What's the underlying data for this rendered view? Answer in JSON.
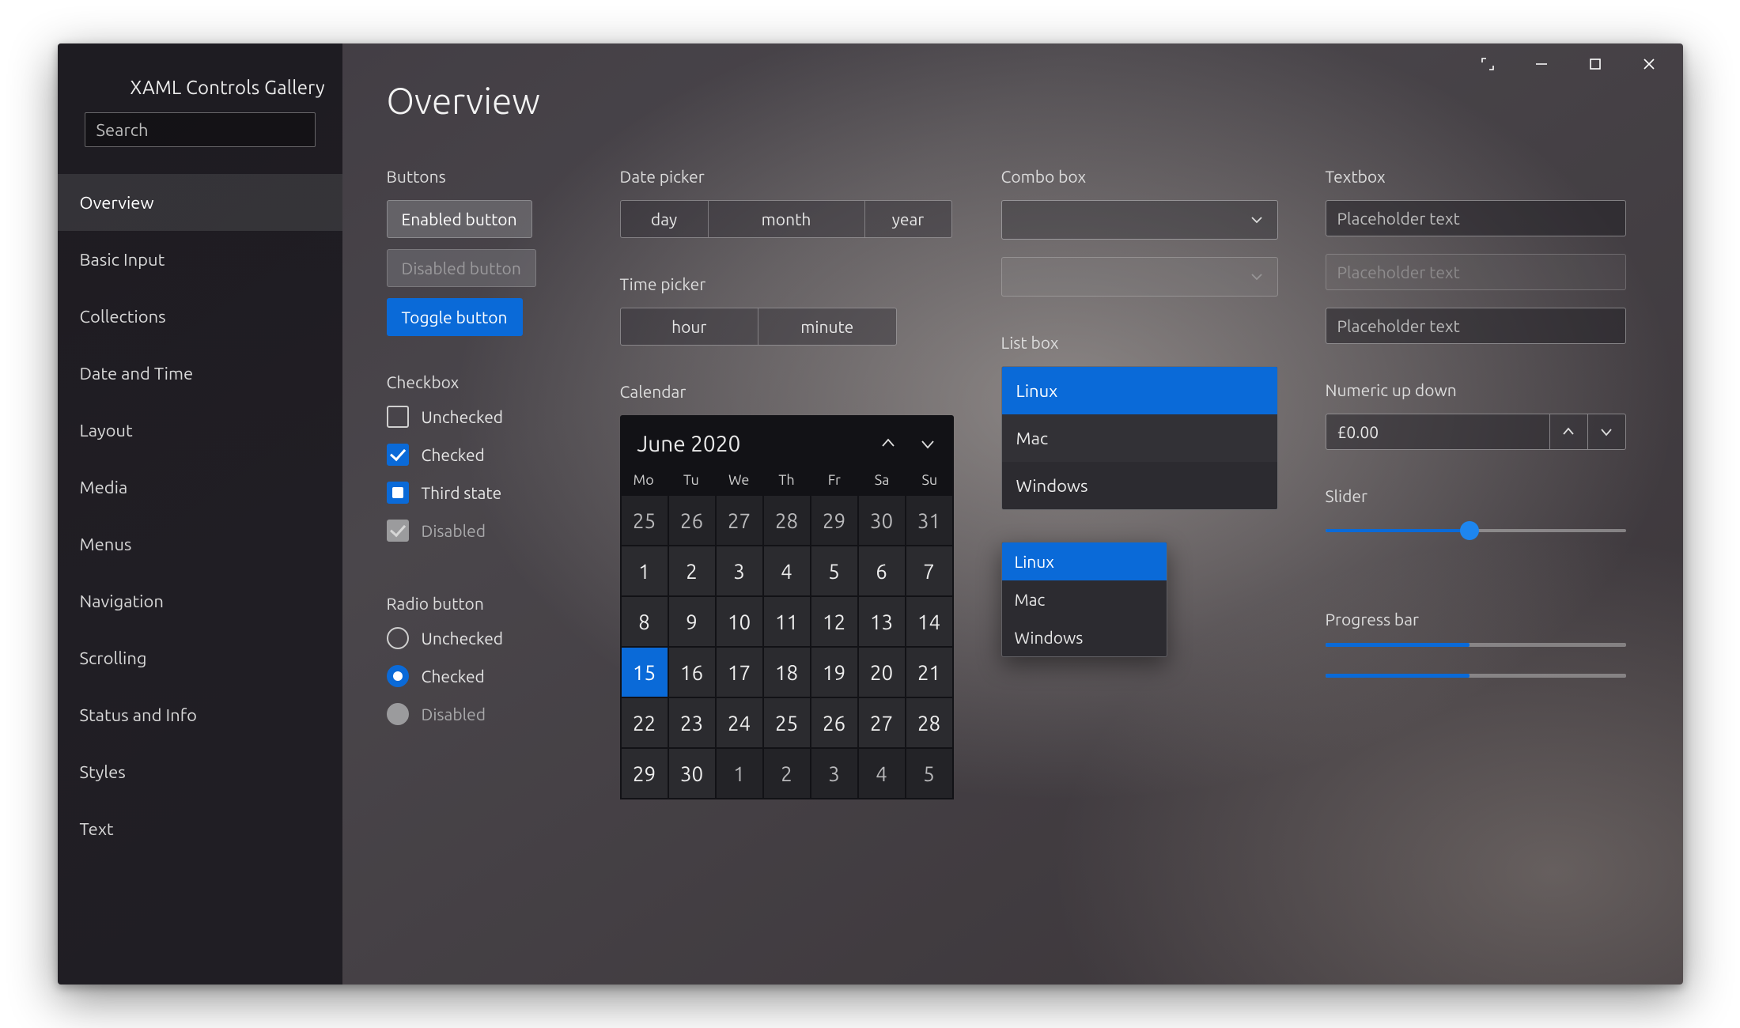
{
  "app_title": "XAML Controls Gallery",
  "search_placeholder": "Search",
  "nav": [
    "Overview",
    "Basic Input",
    "Collections",
    "Date and Time",
    "Layout",
    "Media",
    "Menus",
    "Navigation",
    "Scrolling",
    "Status and Info",
    "Styles",
    "Text"
  ],
  "nav_selected": 0,
  "page_title": "Overview",
  "sections": {
    "buttons": "Buttons",
    "checkbox": "Checkbox",
    "radio": "Radio button",
    "datepicker": "Date picker",
    "timepicker": "Time picker",
    "calendar": "Calendar",
    "combobox": "Combo box",
    "listbox": "List box",
    "textbox": "Textbox",
    "numeric": "Numeric up down",
    "slider": "Slider",
    "progress": "Progress bar"
  },
  "buttons": {
    "enabled": "Enabled button",
    "disabled": "Disabled button",
    "toggle": "Toggle button"
  },
  "checkboxes": {
    "unchecked": "Unchecked",
    "checked": "Checked",
    "third": "Third state",
    "disabled": "Disabled"
  },
  "radios": {
    "unchecked": "Unchecked",
    "checked": "Checked",
    "disabled": "Disabled"
  },
  "datepicker": {
    "day": "day",
    "month": "month",
    "year": "year"
  },
  "timepicker": {
    "hour": "hour",
    "minute": "minute"
  },
  "calendar": {
    "title": "June 2020",
    "dow": [
      "Mo",
      "Tu",
      "We",
      "Th",
      "Fr",
      "Sa",
      "Su"
    ],
    "cells": [
      {
        "d": "25",
        "adj": true
      },
      {
        "d": "26",
        "adj": true
      },
      {
        "d": "27",
        "adj": true
      },
      {
        "d": "28",
        "adj": true
      },
      {
        "d": "29",
        "adj": true
      },
      {
        "d": "30",
        "adj": true
      },
      {
        "d": "31",
        "adj": true
      },
      {
        "d": "1"
      },
      {
        "d": "2"
      },
      {
        "d": "3"
      },
      {
        "d": "4"
      },
      {
        "d": "5"
      },
      {
        "d": "6"
      },
      {
        "d": "7"
      },
      {
        "d": "8"
      },
      {
        "d": "9"
      },
      {
        "d": "10"
      },
      {
        "d": "11"
      },
      {
        "d": "12"
      },
      {
        "d": "13"
      },
      {
        "d": "14"
      },
      {
        "d": "15",
        "sel": true
      },
      {
        "d": "16"
      },
      {
        "d": "17"
      },
      {
        "d": "18"
      },
      {
        "d": "19"
      },
      {
        "d": "20"
      },
      {
        "d": "21"
      },
      {
        "d": "22"
      },
      {
        "d": "23"
      },
      {
        "d": "24"
      },
      {
        "d": "25"
      },
      {
        "d": "26"
      },
      {
        "d": "27"
      },
      {
        "d": "28"
      },
      {
        "d": "29"
      },
      {
        "d": "30"
      },
      {
        "d": "1",
        "adj": true
      },
      {
        "d": "2",
        "adj": true
      },
      {
        "d": "3",
        "adj": true
      },
      {
        "d": "4",
        "adj": true
      },
      {
        "d": "5",
        "adj": true
      }
    ]
  },
  "listbox_items": [
    "Linux",
    "Mac",
    "Windows"
  ],
  "listbox_selected": 0,
  "dropdown_items": [
    "Linux",
    "Mac",
    "Windows"
  ],
  "dropdown_selected": 0,
  "textbox_placeholder": "Placeholder text",
  "numeric_value": "£0.00",
  "slider_percent": 48,
  "progress_percent": 48
}
